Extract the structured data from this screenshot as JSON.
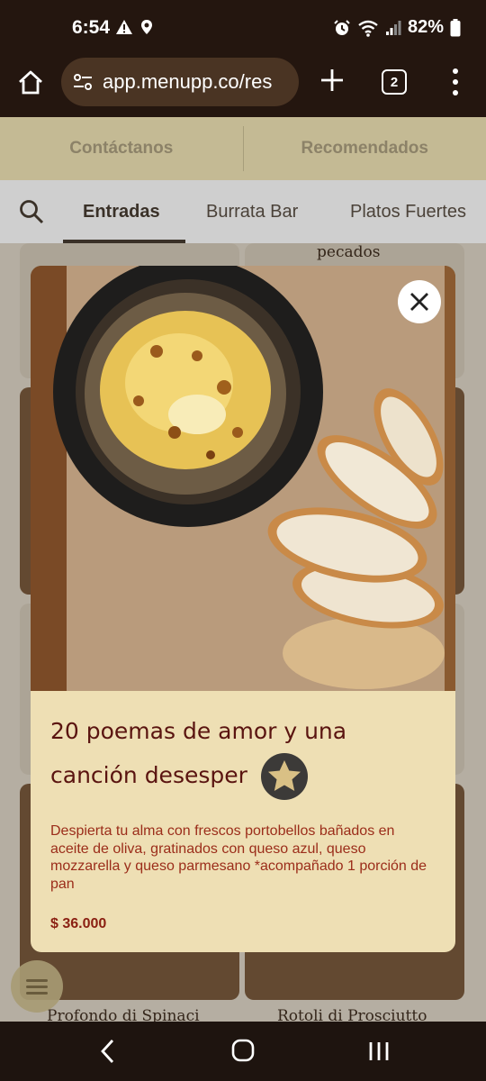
{
  "status_bar": {
    "time": "6:54",
    "battery": "82%",
    "icons": [
      "alert-icon",
      "location-icon",
      "alarm-icon",
      "wifi-icon",
      "signal-icon",
      "battery-icon"
    ]
  },
  "browser": {
    "url": "app.menupp.co/res",
    "tab_count": "2"
  },
  "top_nav": {
    "items": [
      {
        "label": "Contáctanos"
      },
      {
        "label": "Recomendados"
      }
    ]
  },
  "categories": {
    "tabs": [
      {
        "label": "Entradas",
        "active": true
      },
      {
        "label": "Burrata Bar",
        "active": false
      },
      {
        "label": "Platos Fuertes",
        "active": false
      }
    ]
  },
  "background_cards": {
    "labels": [
      "pecados",
      "Profondo di Spinaci",
      "Rotoli di Prosciutto"
    ]
  },
  "modal": {
    "title": "20 poemas de amor y una canción desesper",
    "description": "Despierta tu alma con frescos portobellos bañados en aceite de oliva, gratinados con queso azul, queso mozzarella y queso parmesano *acompañado 1 porción de pan",
    "price": "$ 36.000",
    "colors": {
      "panel": "#eedfb4",
      "title": "#5a1410",
      "description": "#9b2d1a"
    }
  }
}
